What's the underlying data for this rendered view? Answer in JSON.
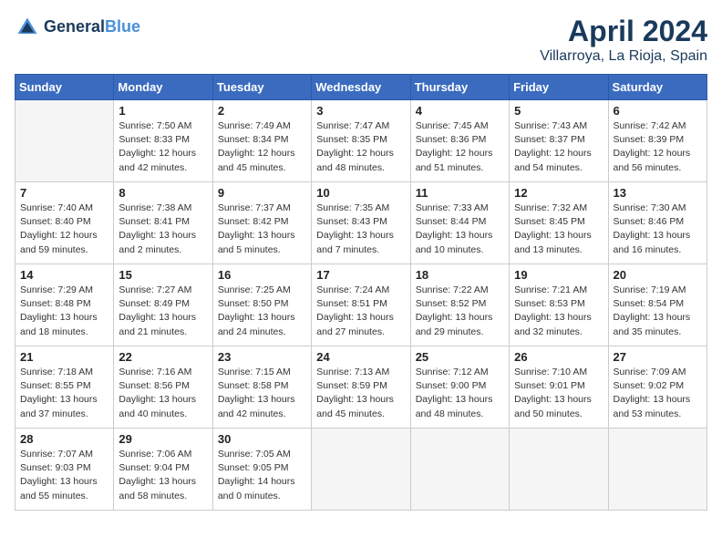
{
  "header": {
    "logo_line1": "General",
    "logo_line2": "Blue",
    "title": "April 2024",
    "subtitle": "Villarroya, La Rioja, Spain"
  },
  "weekdays": [
    "Sunday",
    "Monday",
    "Tuesday",
    "Wednesday",
    "Thursday",
    "Friday",
    "Saturday"
  ],
  "weeks": [
    [
      {
        "day": "",
        "info": ""
      },
      {
        "day": "1",
        "info": "Sunrise: 7:50 AM\nSunset: 8:33 PM\nDaylight: 12 hours\nand 42 minutes."
      },
      {
        "day": "2",
        "info": "Sunrise: 7:49 AM\nSunset: 8:34 PM\nDaylight: 12 hours\nand 45 minutes."
      },
      {
        "day": "3",
        "info": "Sunrise: 7:47 AM\nSunset: 8:35 PM\nDaylight: 12 hours\nand 48 minutes."
      },
      {
        "day": "4",
        "info": "Sunrise: 7:45 AM\nSunset: 8:36 PM\nDaylight: 12 hours\nand 51 minutes."
      },
      {
        "day": "5",
        "info": "Sunrise: 7:43 AM\nSunset: 8:37 PM\nDaylight: 12 hours\nand 54 minutes."
      },
      {
        "day": "6",
        "info": "Sunrise: 7:42 AM\nSunset: 8:39 PM\nDaylight: 12 hours\nand 56 minutes."
      }
    ],
    [
      {
        "day": "7",
        "info": "Sunrise: 7:40 AM\nSunset: 8:40 PM\nDaylight: 12 hours\nand 59 minutes."
      },
      {
        "day": "8",
        "info": "Sunrise: 7:38 AM\nSunset: 8:41 PM\nDaylight: 13 hours\nand 2 minutes."
      },
      {
        "day": "9",
        "info": "Sunrise: 7:37 AM\nSunset: 8:42 PM\nDaylight: 13 hours\nand 5 minutes."
      },
      {
        "day": "10",
        "info": "Sunrise: 7:35 AM\nSunset: 8:43 PM\nDaylight: 13 hours\nand 7 minutes."
      },
      {
        "day": "11",
        "info": "Sunrise: 7:33 AM\nSunset: 8:44 PM\nDaylight: 13 hours\nand 10 minutes."
      },
      {
        "day": "12",
        "info": "Sunrise: 7:32 AM\nSunset: 8:45 PM\nDaylight: 13 hours\nand 13 minutes."
      },
      {
        "day": "13",
        "info": "Sunrise: 7:30 AM\nSunset: 8:46 PM\nDaylight: 13 hours\nand 16 minutes."
      }
    ],
    [
      {
        "day": "14",
        "info": "Sunrise: 7:29 AM\nSunset: 8:48 PM\nDaylight: 13 hours\nand 18 minutes."
      },
      {
        "day": "15",
        "info": "Sunrise: 7:27 AM\nSunset: 8:49 PM\nDaylight: 13 hours\nand 21 minutes."
      },
      {
        "day": "16",
        "info": "Sunrise: 7:25 AM\nSunset: 8:50 PM\nDaylight: 13 hours\nand 24 minutes."
      },
      {
        "day": "17",
        "info": "Sunrise: 7:24 AM\nSunset: 8:51 PM\nDaylight: 13 hours\nand 27 minutes."
      },
      {
        "day": "18",
        "info": "Sunrise: 7:22 AM\nSunset: 8:52 PM\nDaylight: 13 hours\nand 29 minutes."
      },
      {
        "day": "19",
        "info": "Sunrise: 7:21 AM\nSunset: 8:53 PM\nDaylight: 13 hours\nand 32 minutes."
      },
      {
        "day": "20",
        "info": "Sunrise: 7:19 AM\nSunset: 8:54 PM\nDaylight: 13 hours\nand 35 minutes."
      }
    ],
    [
      {
        "day": "21",
        "info": "Sunrise: 7:18 AM\nSunset: 8:55 PM\nDaylight: 13 hours\nand 37 minutes."
      },
      {
        "day": "22",
        "info": "Sunrise: 7:16 AM\nSunset: 8:56 PM\nDaylight: 13 hours\nand 40 minutes."
      },
      {
        "day": "23",
        "info": "Sunrise: 7:15 AM\nSunset: 8:58 PM\nDaylight: 13 hours\nand 42 minutes."
      },
      {
        "day": "24",
        "info": "Sunrise: 7:13 AM\nSunset: 8:59 PM\nDaylight: 13 hours\nand 45 minutes."
      },
      {
        "day": "25",
        "info": "Sunrise: 7:12 AM\nSunset: 9:00 PM\nDaylight: 13 hours\nand 48 minutes."
      },
      {
        "day": "26",
        "info": "Sunrise: 7:10 AM\nSunset: 9:01 PM\nDaylight: 13 hours\nand 50 minutes."
      },
      {
        "day": "27",
        "info": "Sunrise: 7:09 AM\nSunset: 9:02 PM\nDaylight: 13 hours\nand 53 minutes."
      }
    ],
    [
      {
        "day": "28",
        "info": "Sunrise: 7:07 AM\nSunset: 9:03 PM\nDaylight: 13 hours\nand 55 minutes."
      },
      {
        "day": "29",
        "info": "Sunrise: 7:06 AM\nSunset: 9:04 PM\nDaylight: 13 hours\nand 58 minutes."
      },
      {
        "day": "30",
        "info": "Sunrise: 7:05 AM\nSunset: 9:05 PM\nDaylight: 14 hours\nand 0 minutes."
      },
      {
        "day": "",
        "info": ""
      },
      {
        "day": "",
        "info": ""
      },
      {
        "day": "",
        "info": ""
      },
      {
        "day": "",
        "info": ""
      }
    ]
  ]
}
